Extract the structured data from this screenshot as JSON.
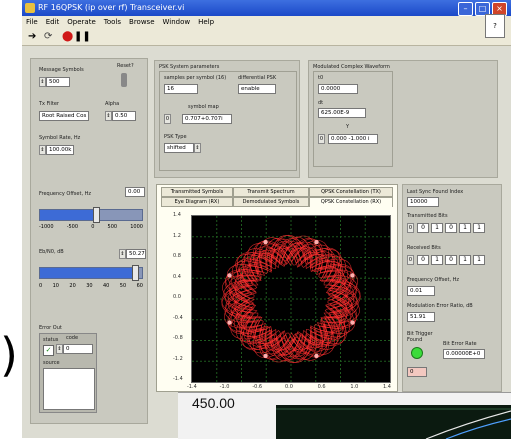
{
  "window": {
    "title": "RF 16QPSK (ip over rf) Transceiver.vi"
  },
  "menu": [
    "File",
    "Edit",
    "Operate",
    "Tools",
    "Browse",
    "Window",
    "Help"
  ],
  "left": {
    "message_symbols_label": "Message Symbols",
    "message_symbols_value": "500",
    "reset_label": "Reset?",
    "tx_filter_label": "Tx Filter",
    "tx_filter_value": "Root Raised Cos",
    "alpha_label": "Alpha",
    "alpha_value": "0.50",
    "symbol_rate_label": "Symbol Rate, Hz",
    "symbol_rate_value": "100.00k",
    "freq_offset_label": "Frequency Offset, Hz",
    "freq_offset_value": "0.00",
    "freq_offset_level": 0.55,
    "freq_scale": [
      "-1000",
      "-500",
      "0",
      "500",
      "1000"
    ],
    "ebno_label": "Eb/N0, dB",
    "ebno_value": "50.27",
    "ebno_level": 0.93,
    "ebno_scale": [
      "0",
      "10",
      "20",
      "30",
      "40",
      "50",
      "60"
    ],
    "error_out_label": "Error Out",
    "status_label": "status",
    "code_label": "code",
    "code_value": "0",
    "source_label": "source"
  },
  "params": {
    "title": "PSK System parameters",
    "spl_label": "samples per symbol (16)",
    "spl_value": "16",
    "diff_label": "differential PSK",
    "diff_value": "enable",
    "symbol_map_label": "symbol map",
    "symbol_map_value": "0.707+0.707i",
    "psk_type_label": "PSK Type",
    "psk_type_value": "shifted"
  },
  "waveform": {
    "title": "Modulated Complex Waveform",
    "t0_label": "t0",
    "t0_value": "0.0000",
    "dt_label": "dt",
    "dt_value": "625.00E-9",
    "y_label": "Y",
    "y_value": "0.000 -1.000 i"
  },
  "tabs": {
    "row1": [
      "Transmitted Symbols",
      "Transmit Spectrum",
      "QPSK Constellation (TX)"
    ],
    "row2": [
      "Eye Diagram (RX)",
      "Demodulated Symbols",
      "QPSK Constellation (RX)"
    ]
  },
  "plot": {
    "y_ticks": [
      "1.4",
      "1.2",
      "0.8",
      "0.4",
      "0.0",
      "-0.4",
      "-0.8",
      "-1.2",
      "-1.4"
    ],
    "x_ticks": [
      "-1.4",
      "-1.0",
      "-0.6",
      "0.0",
      "0.6",
      "1.0",
      "1.4"
    ],
    "trace_color": "#ff3030",
    "grid_color": "#1e5a1e"
  },
  "right": {
    "last_sync_label": "Last Sync Found Index",
    "last_sync_value": "10000",
    "tx_bits_label": "Transmitted Bits",
    "tx_bits": [
      "0",
      "1",
      "0",
      "1",
      "1"
    ],
    "rx_bits_label": "Received Bits",
    "rx_bits": [
      "0",
      "1",
      "0",
      "1",
      "1"
    ],
    "freq_offset_hz_label": "Frequency Offset, Hz",
    "freq_offset_hz_value": "0.01",
    "mer_label": "Modulation Error Ratio, dB",
    "mer_value": "51.91",
    "trigger_label": "Bit Trigger Found",
    "ber_label": "Bit Error Rate",
    "ber_value": "0.00000E+0",
    "index_value": "0"
  },
  "overlay": {
    "value": "450.00"
  },
  "paren": ")"
}
